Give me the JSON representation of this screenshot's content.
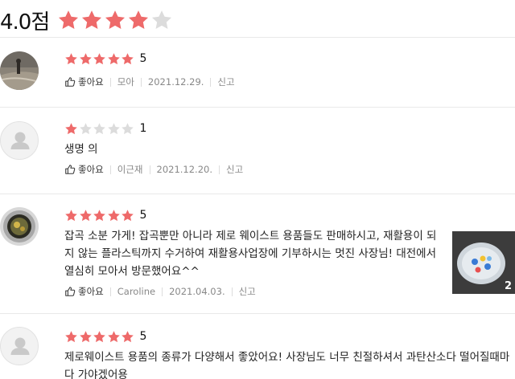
{
  "summary": {
    "score_text": "4.0점",
    "rating": 4,
    "max": 5
  },
  "colors": {
    "star_on": "#ee6a6a",
    "star_off": "#dcdcdc"
  },
  "reviews": [
    {
      "rating": 5,
      "rating_text": "5",
      "text": "",
      "like_label": "좋아요",
      "author": "모아",
      "date": "2021.12.29.",
      "report_label": "신고",
      "avatar": "photo-beach"
    },
    {
      "rating": 1,
      "rating_text": "1",
      "text": "생명 의",
      "like_label": "좋아요",
      "author": "이근재",
      "date": "2021.12.20.",
      "report_label": "신고",
      "avatar": "default"
    },
    {
      "rating": 5,
      "rating_text": "5",
      "text": "잡곡 소분 가게! 잡곡뿐만 아니라 제로 웨이스트 용품들도 판매하시고, 재활용이 되지 않는 플라스틱까지 수거하여 재활용사업장에 기부하시는 멋진 사장님! 대전에서 열심히 모아서 방문했어요^^",
      "like_label": "좋아요",
      "author": "Caroline",
      "date": "2021.04.03.",
      "report_label": "신고",
      "avatar": "photo-round",
      "photo_count": "2"
    },
    {
      "rating": 5,
      "rating_text": "5",
      "text": "제로웨이스트 용품의 종류가 다양해서 좋았어요! 사장님도 너무 친절하셔서 과탄산소다 떨어질때마다 가야겠어용",
      "avatar": "default"
    }
  ]
}
